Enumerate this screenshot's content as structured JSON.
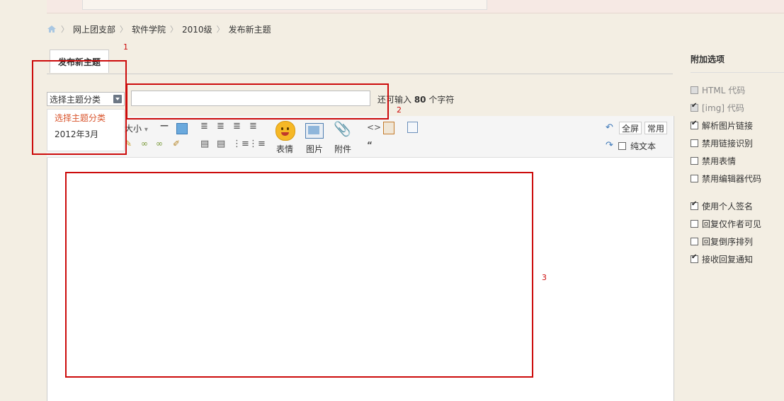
{
  "breadcrumb": {
    "items": [
      "网上团支部",
      "软件学院",
      "2010级",
      "发布新主题"
    ]
  },
  "tab": {
    "label": "发布新主题"
  },
  "type_select": {
    "value": "选择主题分类",
    "options": [
      "选择主题分类",
      "2012年3月"
    ]
  },
  "remaining": {
    "prefix": "还可输入 ",
    "count": "80",
    "suffix": " 个字符"
  },
  "toolbar": {
    "font_size": "大小",
    "emoji": "表情",
    "image": "图片",
    "attachment": "附件",
    "fullscreen": "全屏",
    "common": "常用",
    "plain_text": "纯文本",
    "quote_icon": "quote-icon"
  },
  "annotations": {
    "a1": "1",
    "a2": "2",
    "a3": "3"
  },
  "sidebar": {
    "title": "附加选项",
    "options": [
      {
        "label": "HTML 代码",
        "checked": false,
        "disabled": true
      },
      {
        "label": "[img] 代码",
        "checked": true,
        "disabled": true
      },
      {
        "label": "解析图片链接",
        "checked": true,
        "disabled": false
      },
      {
        "label": "禁用链接识别",
        "checked": false,
        "disabled": false
      },
      {
        "label": "禁用表情",
        "checked": false,
        "disabled": false
      },
      {
        "label": "禁用编辑器代码",
        "checked": false,
        "disabled": false
      },
      {
        "label": "使用个人签名",
        "checked": true,
        "disabled": false
      },
      {
        "label": "回复仅作者可见",
        "checked": false,
        "disabled": false
      },
      {
        "label": "回复倒序排列",
        "checked": false,
        "disabled": false
      },
      {
        "label": "接收回复通知",
        "checked": true,
        "disabled": false
      }
    ]
  },
  "colors": {
    "annotation_red": "#cc0b0b",
    "selected_option": "#d9542c",
    "page_bg": "#f3eee3"
  }
}
